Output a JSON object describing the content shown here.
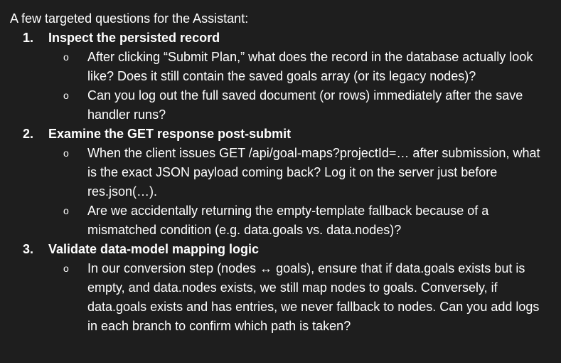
{
  "intro": "A few targeted questions for the Assistant:",
  "bullet_glyph": "o",
  "sections": [
    {
      "num": "1.",
      "title": "Inspect the persisted record",
      "bullets": [
        "After clicking “Submit Plan,” what does the record in the database actually look like? Does it still contain the saved goals array (or its legacy nodes)?",
        "Can you log out the full saved document (or rows) immediately after the save handler runs?"
      ]
    },
    {
      "num": "2.",
      "title": "Examine the GET response post-submit",
      "bullets": [
        "When the client issues GET /api/goal-maps?projectId=… after submission, what is the exact JSON payload coming back? Log it on the server just before res.json(…).",
        "Are we accidentally returning the empty-template fallback because of a mismatched condition (e.g. data.goals vs. data.nodes)?"
      ]
    },
    {
      "num": "3.",
      "title": "Validate data-model mapping logic",
      "bullets": [
        "In our conversion step (nodes ↔ goals), ensure that if data.goals exists but is empty, and data.nodes exists, we still map nodes to goals. Conversely, if data.goals exists and has entries, we never fallback to nodes. Can you add logs in each branch to confirm which path is taken?"
      ]
    }
  ]
}
